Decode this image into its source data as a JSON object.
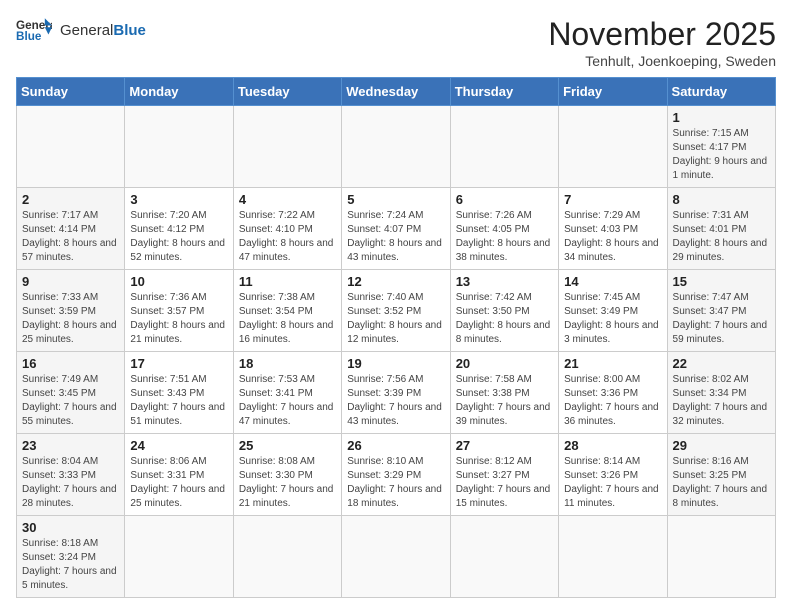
{
  "header": {
    "logo_general": "General",
    "logo_blue": "Blue",
    "month_title": "November 2025",
    "location": "Tenhult, Joenkoeping, Sweden"
  },
  "days_of_week": [
    "Sunday",
    "Monday",
    "Tuesday",
    "Wednesday",
    "Thursday",
    "Friday",
    "Saturday"
  ],
  "weeks": [
    [
      {
        "day": "",
        "info": ""
      },
      {
        "day": "",
        "info": ""
      },
      {
        "day": "",
        "info": ""
      },
      {
        "day": "",
        "info": ""
      },
      {
        "day": "",
        "info": ""
      },
      {
        "day": "",
        "info": ""
      },
      {
        "day": "1",
        "info": "Sunrise: 7:15 AM\nSunset: 4:17 PM\nDaylight: 9 hours and 1 minute."
      }
    ],
    [
      {
        "day": "2",
        "info": "Sunrise: 7:17 AM\nSunset: 4:14 PM\nDaylight: 8 hours and 57 minutes."
      },
      {
        "day": "3",
        "info": "Sunrise: 7:20 AM\nSunset: 4:12 PM\nDaylight: 8 hours and 52 minutes."
      },
      {
        "day": "4",
        "info": "Sunrise: 7:22 AM\nSunset: 4:10 PM\nDaylight: 8 hours and 47 minutes."
      },
      {
        "day": "5",
        "info": "Sunrise: 7:24 AM\nSunset: 4:07 PM\nDaylight: 8 hours and 43 minutes."
      },
      {
        "day": "6",
        "info": "Sunrise: 7:26 AM\nSunset: 4:05 PM\nDaylight: 8 hours and 38 minutes."
      },
      {
        "day": "7",
        "info": "Sunrise: 7:29 AM\nSunset: 4:03 PM\nDaylight: 8 hours and 34 minutes."
      },
      {
        "day": "8",
        "info": "Sunrise: 7:31 AM\nSunset: 4:01 PM\nDaylight: 8 hours and 29 minutes."
      }
    ],
    [
      {
        "day": "9",
        "info": "Sunrise: 7:33 AM\nSunset: 3:59 PM\nDaylight: 8 hours and 25 minutes."
      },
      {
        "day": "10",
        "info": "Sunrise: 7:36 AM\nSunset: 3:57 PM\nDaylight: 8 hours and 21 minutes."
      },
      {
        "day": "11",
        "info": "Sunrise: 7:38 AM\nSunset: 3:54 PM\nDaylight: 8 hours and 16 minutes."
      },
      {
        "day": "12",
        "info": "Sunrise: 7:40 AM\nSunset: 3:52 PM\nDaylight: 8 hours and 12 minutes."
      },
      {
        "day": "13",
        "info": "Sunrise: 7:42 AM\nSunset: 3:50 PM\nDaylight: 8 hours and 8 minutes."
      },
      {
        "day": "14",
        "info": "Sunrise: 7:45 AM\nSunset: 3:49 PM\nDaylight: 8 hours and 3 minutes."
      },
      {
        "day": "15",
        "info": "Sunrise: 7:47 AM\nSunset: 3:47 PM\nDaylight: 7 hours and 59 minutes."
      }
    ],
    [
      {
        "day": "16",
        "info": "Sunrise: 7:49 AM\nSunset: 3:45 PM\nDaylight: 7 hours and 55 minutes."
      },
      {
        "day": "17",
        "info": "Sunrise: 7:51 AM\nSunset: 3:43 PM\nDaylight: 7 hours and 51 minutes."
      },
      {
        "day": "18",
        "info": "Sunrise: 7:53 AM\nSunset: 3:41 PM\nDaylight: 7 hours and 47 minutes."
      },
      {
        "day": "19",
        "info": "Sunrise: 7:56 AM\nSunset: 3:39 PM\nDaylight: 7 hours and 43 minutes."
      },
      {
        "day": "20",
        "info": "Sunrise: 7:58 AM\nSunset: 3:38 PM\nDaylight: 7 hours and 39 minutes."
      },
      {
        "day": "21",
        "info": "Sunrise: 8:00 AM\nSunset: 3:36 PM\nDaylight: 7 hours and 36 minutes."
      },
      {
        "day": "22",
        "info": "Sunrise: 8:02 AM\nSunset: 3:34 PM\nDaylight: 7 hours and 32 minutes."
      }
    ],
    [
      {
        "day": "23",
        "info": "Sunrise: 8:04 AM\nSunset: 3:33 PM\nDaylight: 7 hours and 28 minutes."
      },
      {
        "day": "24",
        "info": "Sunrise: 8:06 AM\nSunset: 3:31 PM\nDaylight: 7 hours and 25 minutes."
      },
      {
        "day": "25",
        "info": "Sunrise: 8:08 AM\nSunset: 3:30 PM\nDaylight: 7 hours and 21 minutes."
      },
      {
        "day": "26",
        "info": "Sunrise: 8:10 AM\nSunset: 3:29 PM\nDaylight: 7 hours and 18 minutes."
      },
      {
        "day": "27",
        "info": "Sunrise: 8:12 AM\nSunset: 3:27 PM\nDaylight: 7 hours and 15 minutes."
      },
      {
        "day": "28",
        "info": "Sunrise: 8:14 AM\nSunset: 3:26 PM\nDaylight: 7 hours and 11 minutes."
      },
      {
        "day": "29",
        "info": "Sunrise: 8:16 AM\nSunset: 3:25 PM\nDaylight: 7 hours and 8 minutes."
      }
    ],
    [
      {
        "day": "30",
        "info": "Sunrise: 8:18 AM\nSunset: 3:24 PM\nDaylight: 7 hours and 5 minutes."
      },
      {
        "day": "",
        "info": ""
      },
      {
        "day": "",
        "info": ""
      },
      {
        "day": "",
        "info": ""
      },
      {
        "day": "",
        "info": ""
      },
      {
        "day": "",
        "info": ""
      },
      {
        "day": "",
        "info": ""
      }
    ]
  ]
}
